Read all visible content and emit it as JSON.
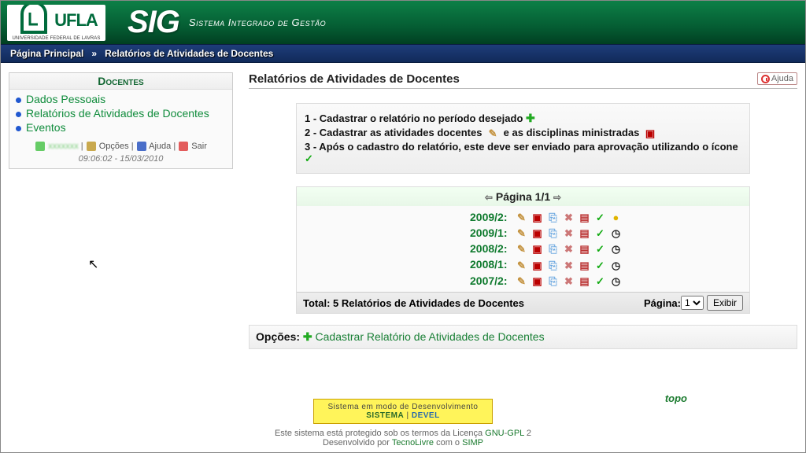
{
  "header": {
    "sig": "SIG",
    "subtitle": "Sistema Integrado de Gestão",
    "ufla_sub": "UNIVERSIDADE FEDERAL DE LAVRAS"
  },
  "breadcrumb": {
    "home": "Página Principal",
    "sep": "»",
    "current": "Relatórios de Atividades de Docentes"
  },
  "sidebar": {
    "title": "Docentes",
    "items": [
      {
        "label": "Dados Pessoais"
      },
      {
        "label": "Relatórios de Atividades de Docentes"
      },
      {
        "label": "Eventos"
      }
    ],
    "footer": {
      "opcoes": "Opções",
      "ajuda": "Ajuda",
      "sair": "Sair",
      "sep": " | ",
      "timestamp": "09:06:02 - 15/03/2010"
    }
  },
  "content": {
    "title": "Relatórios de Atividades de Docentes",
    "help": "Ajuda",
    "instructions": {
      "l1a": "1 - Cadastrar o relatório no período desejado ",
      "l2a": "2 - Cadastrar as atividades docentes ",
      "l2b": " e as disciplinas ministradas ",
      "l3": "3 - Após o cadastro do relatório, este deve ser enviado para aprovação utilizando o ícone "
    },
    "pager": {
      "header": "Página 1/1",
      "rows": [
        {
          "period": "2009/2:",
          "status": "star"
        },
        {
          "period": "2009/1:",
          "status": "clock"
        },
        {
          "period": "2008/2:",
          "status": "clock"
        },
        {
          "period": "2008/1:",
          "status": "clock"
        },
        {
          "period": "2007/2:",
          "status": "clock"
        }
      ],
      "total": "Total: 5 Relatórios de Atividades de Docentes",
      "pagina_label": "Página:",
      "page_value": "1",
      "exibir": "Exibir"
    },
    "options": {
      "label": "Opções:",
      "link": "Cadastrar Relatório de Atividades de Docentes"
    }
  },
  "footer": {
    "topo": "topo",
    "devbox_l1": "Sistema em modo de Desenvolvimento",
    "devbox_sys": "SISTEMA",
    "devbox_sep": " | ",
    "devbox_dev": "DEVEL",
    "lic1": "Este sistema está protegido sob os termos da Licença ",
    "gnu": "GNU",
    "dash": "-",
    "gpl": "GPL",
    "two": " 2",
    "dev_by": "Desenvolvido por ",
    "tecno": "TecnoLivre",
    "com": " com o ",
    "simp": "SIMP"
  }
}
